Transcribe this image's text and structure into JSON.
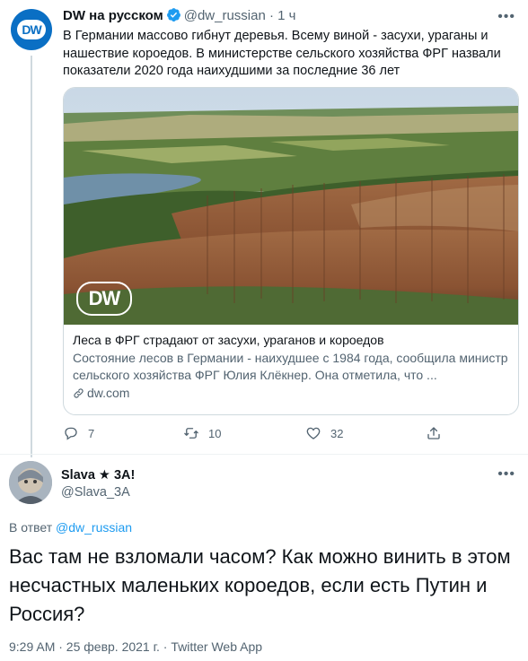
{
  "tweet": {
    "author": {
      "name": "DW на русском",
      "handle": "@dw_russian",
      "time": "· 1 ч",
      "avatar_label": "DW"
    },
    "text": "В Германии массово гибнут деревья. Всему виной - засухи, ураганы и нашествие короедов. В министерстве сельского хозяйства ФРГ назвали показатели 2020 года наихудшими за последние 36 лет",
    "card": {
      "image_logo": "DW",
      "title": "Леса в ФРГ страдают от засухи, ураганов и короедов",
      "description": "Состояние лесов в Германии - наихудшее с 1984 года, сообщила министр сельского хозяйства ФРГ Юлия Клёкнер. Она отметила, что ...",
      "domain": "dw.com"
    },
    "actions": {
      "replies": "7",
      "retweets": "10",
      "likes": "32"
    }
  },
  "reply": {
    "author": {
      "name": "Slava ★ 3A!",
      "handle": "@Slava_3A"
    },
    "reply_prefix": "В ответ",
    "reply_to": "@dw_russian",
    "text": "Вас там не взломали часом? Как можно винить в этом несчастных маленьких короедов, если есть Путин и Россия?",
    "meta": "9:29 AM · 25 февр. 2021 г. · Twitter Web App"
  },
  "colors": {
    "link": "#1d9bf0",
    "muted": "#536471",
    "dw_blue": "#0a6fc4"
  }
}
